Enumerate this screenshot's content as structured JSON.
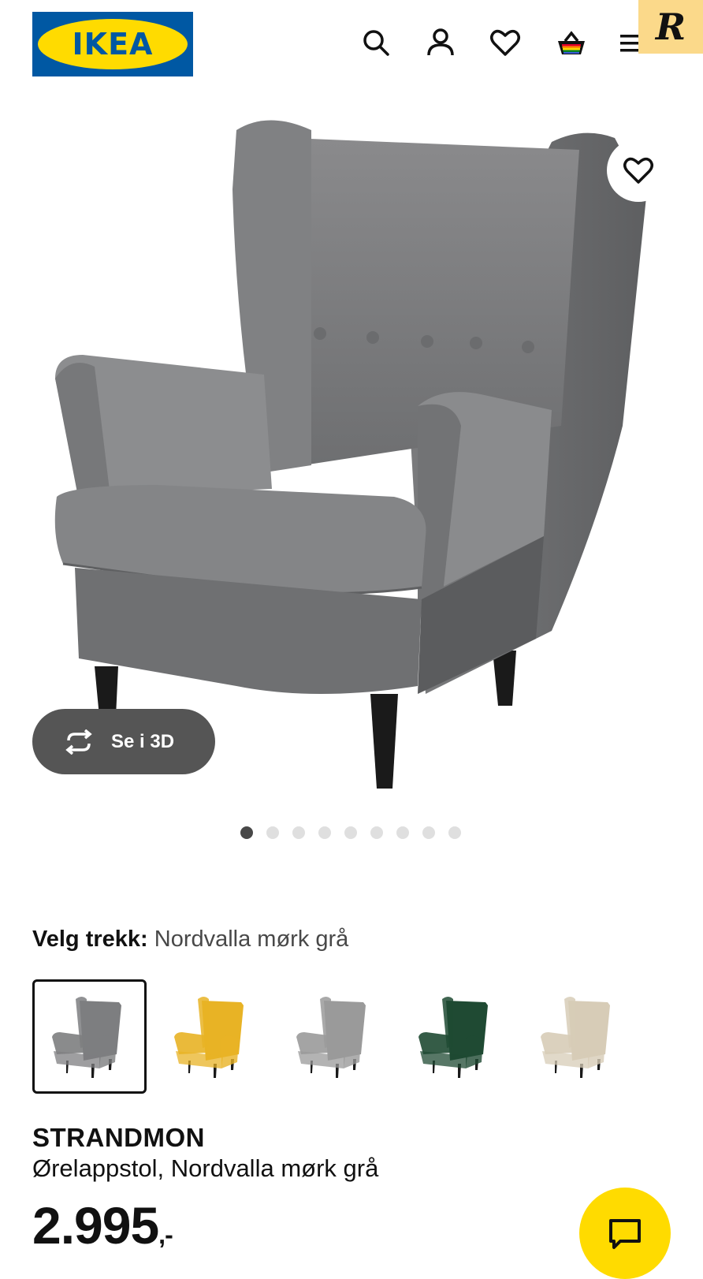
{
  "header": {
    "logo_text": "IKEA",
    "logo_colors": {
      "blue": "#0058a3",
      "yellow": "#ffdb00"
    },
    "icons": [
      "search-icon",
      "account-icon",
      "favourites-icon",
      "basket-icon",
      "menu-icon"
    ],
    "badge_text": "R"
  },
  "gallery": {
    "view_3d_label": "Se i 3D",
    "image_count": 9,
    "active_index": 0
  },
  "cover": {
    "label": "Velg trekk:",
    "value": "Nordvalla mørk grå",
    "options": [
      {
        "name": "Nordvalla mørk grå",
        "color": "#7d7e80",
        "selected": true
      },
      {
        "name": "yellow",
        "color": "#e8b325",
        "selected": false
      },
      {
        "name": "houndstooth grey",
        "color": "#9a9a9a",
        "selected": false
      },
      {
        "name": "dark green",
        "color": "#1f4a33",
        "selected": false
      },
      {
        "name": "beige",
        "color": "#d7ccb7",
        "selected": false
      }
    ]
  },
  "product": {
    "name": "STRANDMON",
    "description": "Ørelappstol, Nordvalla mørk grå",
    "price": "2.995",
    "price_suffix": ",-"
  }
}
